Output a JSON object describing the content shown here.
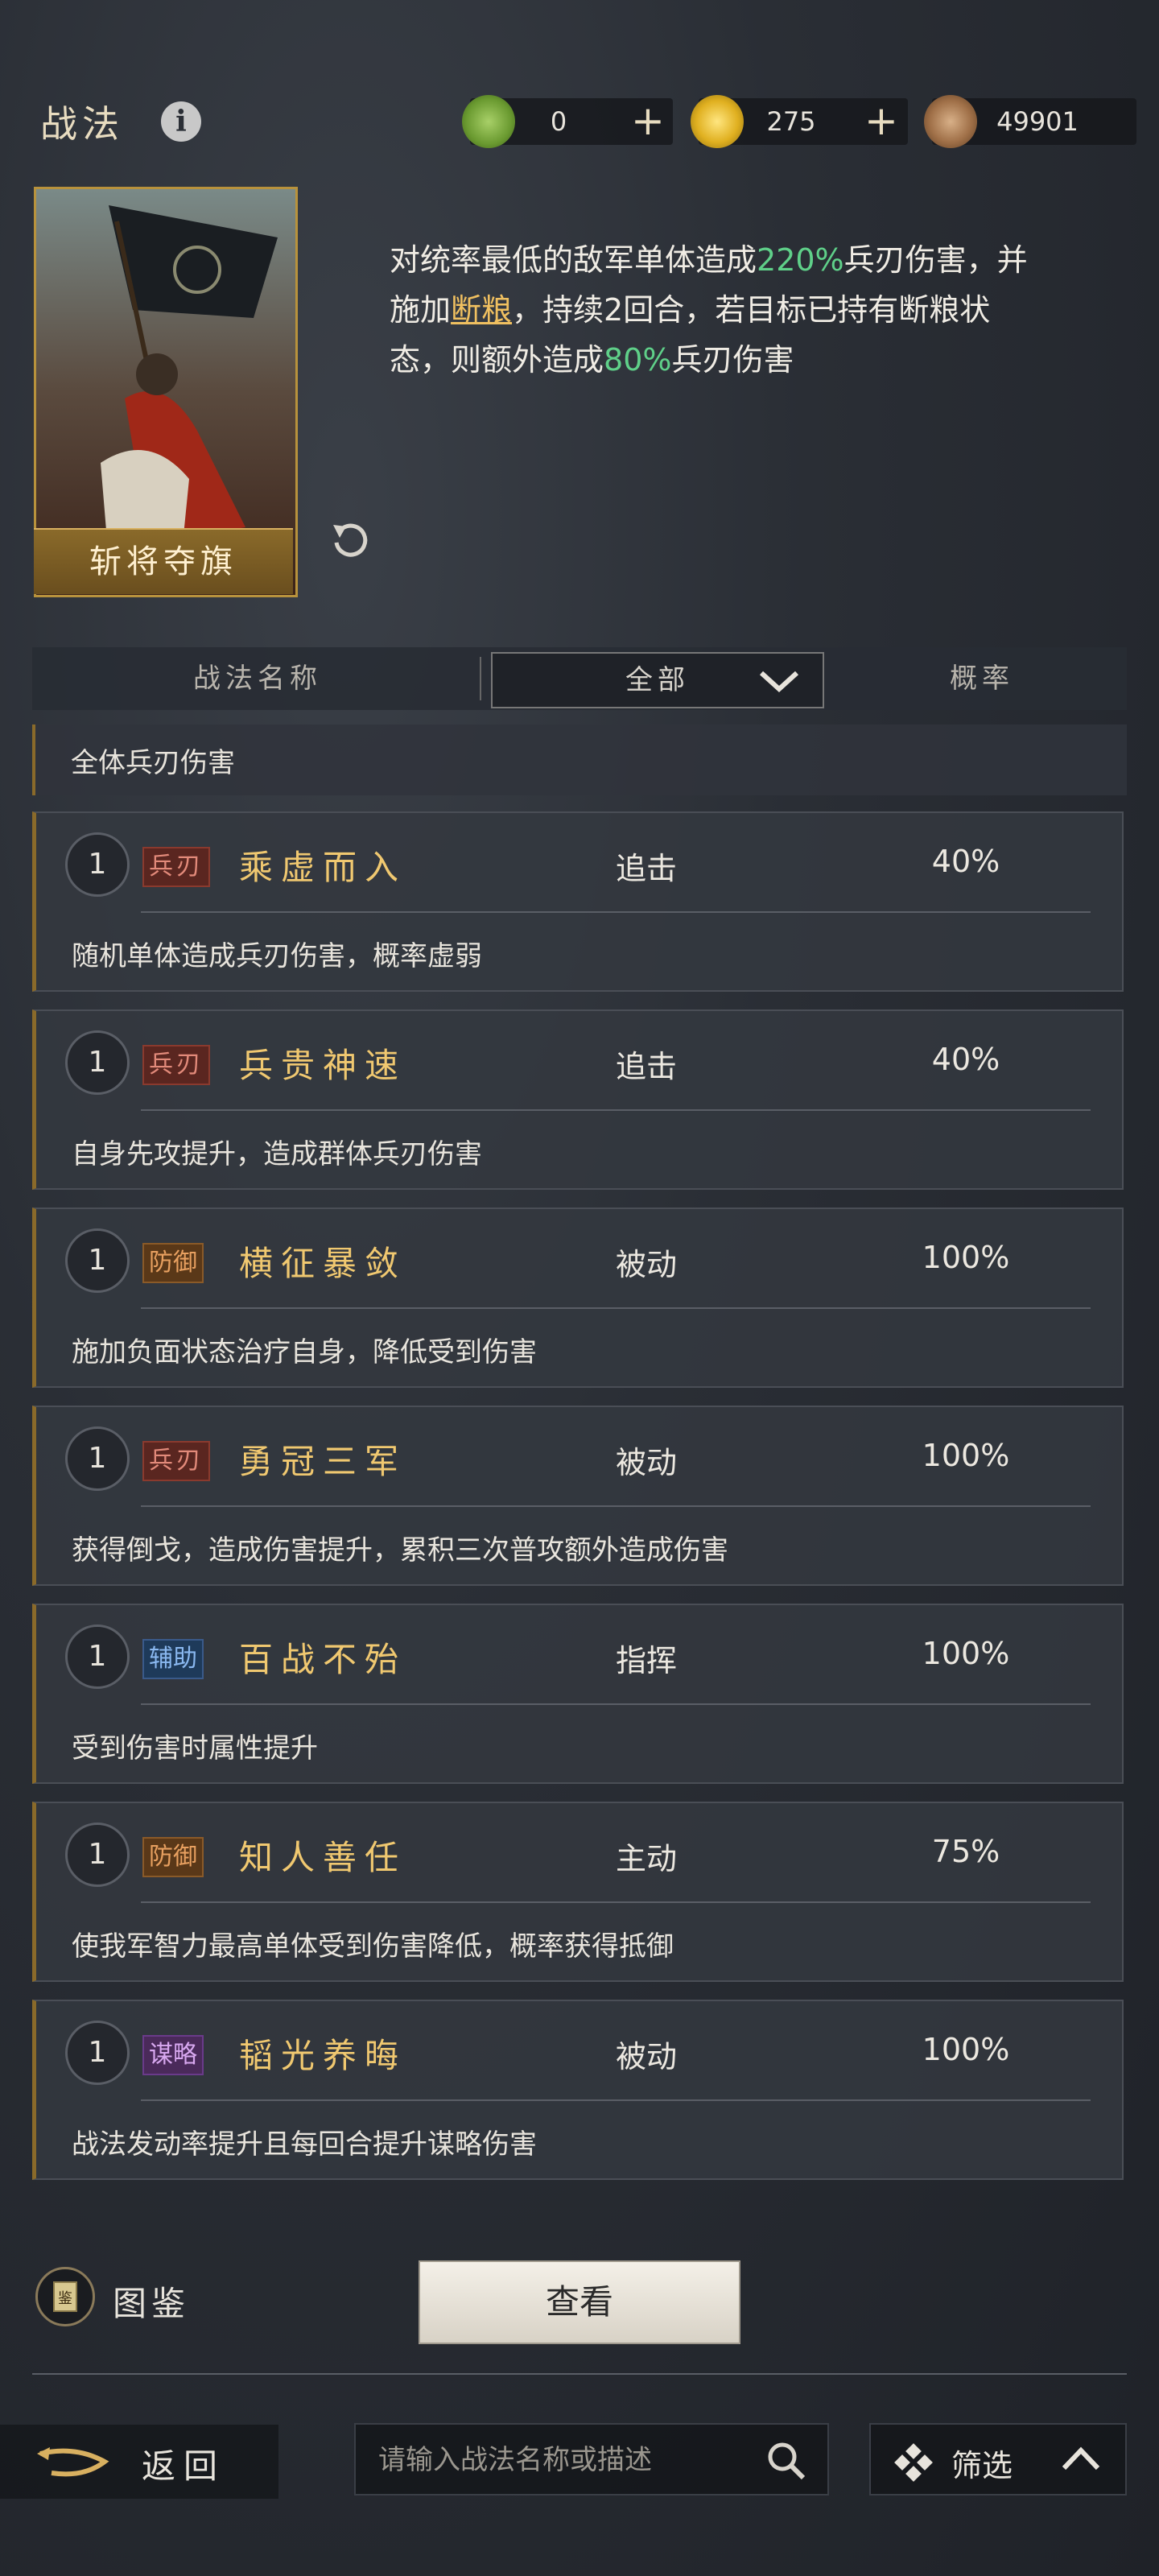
{
  "header": {
    "title": "战法",
    "currencies": [
      {
        "icon": "jade-coin-icon",
        "value": "0",
        "plus": "+"
      },
      {
        "icon": "gold-coin-icon",
        "value": "275",
        "plus": "+"
      },
      {
        "icon": "copper-coin-icon",
        "value": "49901"
      }
    ]
  },
  "hero": {
    "card_name": "斩将夺旗",
    "desc_parts": [
      "对统率最低的敌军单体造成",
      "220%",
      "兵刃伤害，并施加",
      "断粮",
      "，持续2回合，若目标已持有断粮状态，则额外造成",
      "80%",
      "兵刃伤害"
    ]
  },
  "table": {
    "col_name": "战法名称",
    "filter_value": "全部",
    "col_rate": "概率"
  },
  "partial_item_desc": "全体兵刃伤害",
  "skills": [
    {
      "level": "1",
      "tag": "兵刃",
      "tag_kind": "bingren",
      "name": "乘虚而入",
      "type": "追击",
      "rate": "40%",
      "desc": "随机单体造成兵刃伤害，概率虚弱"
    },
    {
      "level": "1",
      "tag": "兵刃",
      "tag_kind": "bingren",
      "name": "兵贵神速",
      "type": "追击",
      "rate": "40%",
      "desc": "自身先攻提升，造成群体兵刃伤害"
    },
    {
      "level": "1",
      "tag": "防御",
      "tag_kind": "fangyu",
      "name": "横征暴敛",
      "type": "被动",
      "rate": "100%",
      "desc": "施加负面状态治疗自身，降低受到伤害"
    },
    {
      "level": "1",
      "tag": "兵刃",
      "tag_kind": "bingren",
      "name": "勇冠三军",
      "type": "被动",
      "rate": "100%",
      "desc": "获得倒戈，造成伤害提升，累积三次普攻额外造成伤害"
    },
    {
      "level": "1",
      "tag": "辅助",
      "tag_kind": "fuzhu",
      "name": "百战不殆",
      "type": "指挥",
      "rate": "100%",
      "desc": "受到伤害时属性提升"
    },
    {
      "level": "1",
      "tag": "防御",
      "tag_kind": "fangyu",
      "name": "知人善任",
      "type": "主动",
      "rate": "75%",
      "desc": "使我军智力最高单体受到伤害降低，概率获得抵御"
    },
    {
      "level": "1",
      "tag": "谋略",
      "tag_kind": "moulue",
      "name": "韬光养晦",
      "type": "被动",
      "rate": "100%",
      "desc": "战法发动率提升且每回合提升谋略伤害"
    }
  ],
  "bottom": {
    "atlas_label": "图鉴",
    "view_label": "查看",
    "back_label": "返回",
    "search_placeholder": "请输入战法名称或描述",
    "filter_label": "筛选"
  }
}
